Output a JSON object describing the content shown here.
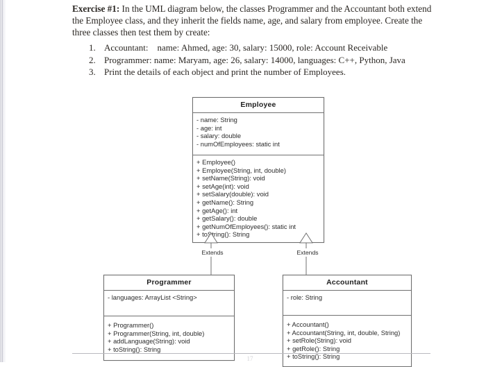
{
  "document": {
    "exercise_label": "Exercise #1:",
    "intro_text": " In the UML diagram below, the classes Programmer and the Accountant both extend the Employee class, and  they inherit the fields name, age, and salary from employee. Create the three classes then test them by create:",
    "tasks": [
      {
        "number": "1.",
        "text": "Accountant:    name: Ahmed, age: 30, salary: 15000, role: Account Receivable"
      },
      {
        "number": "2.",
        "text": "Programmer: name: Maryam, age: 26, salary: 14000, languages: C++, Python, Java"
      },
      {
        "number": "3.",
        "text": "Print the details of each object and print the number of Employees."
      }
    ],
    "footer_page_number": "17"
  },
  "uml": {
    "relationship_label_left": "Extends",
    "relationship_label_right": "Extends",
    "employee": {
      "name": "Employee",
      "attributes": [
        "- name: String",
        "- age: int",
        "- salary: double",
        "- numOfEmployees: static int"
      ],
      "methods": [
        "+ Employee()",
        "+ Employee(String, int, double)",
        "+ setName(String): void",
        "+ setAge(int): void",
        "+ setSalary(double): void",
        "+ getName(): String",
        "+ getAge(): int",
        "+ getSalary(): double",
        "+ getNumOfEmployees(): static int",
        "+ toString(): String"
      ]
    },
    "programmer": {
      "name": "Programmer",
      "attributes": [
        "- languages: ArrayList <String>"
      ],
      "methods": [
        "+ Programmer()",
        "+ Programmer(String, int, double)",
        "+ addLanguage(String): void",
        "+ toString(): String"
      ]
    },
    "accountant": {
      "name": "Accountant",
      "attributes": [
        "- role: String"
      ],
      "methods": [
        "+ Accountant()",
        "+ Accountant(String, int, double, String)",
        "+ setRole(String): void",
        "+ getRole(): String",
        "+ toString(): String"
      ]
    }
  },
  "colors": {
    "border": "#6f6f6f",
    "text": "#2b2b2b",
    "page_background": "#ffffff"
  }
}
